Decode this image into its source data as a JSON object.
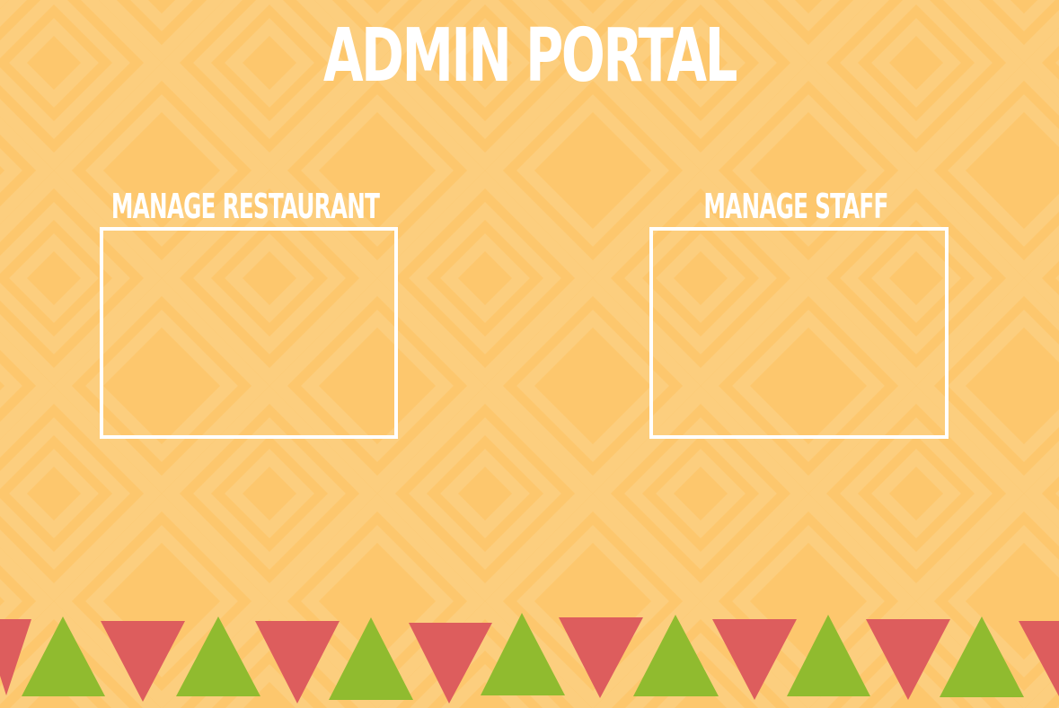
{
  "page": {
    "title": "ADMIN PORTAL"
  },
  "cards": [
    {
      "label": "MANAGE RESTAURANT"
    },
    {
      "label": "MANAGE STAFF"
    }
  ],
  "colors": {
    "background": "#fdc76d",
    "pattern": "#fccf7f",
    "text": "#ffffff",
    "triangle_red": "#dd5d5d",
    "triangle_green": "#90bb2f"
  }
}
